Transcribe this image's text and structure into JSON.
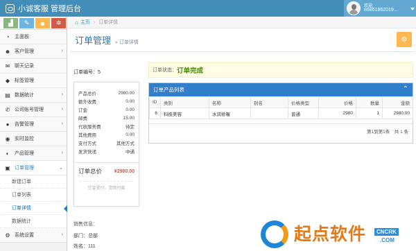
{
  "app": {
    "title": "小诚客服 管理后台"
  },
  "user": {
    "welcome": "欢迎,",
    "phone": "86861862019..."
  },
  "shortcuts": [
    {
      "icon": "signal-icon",
      "glyph": "▟",
      "color": "#87b87f"
    },
    {
      "icon": "pencil-icon",
      "glyph": "✎",
      "color": "#6fb3e0"
    },
    {
      "icon": "users-icon",
      "glyph": "☻",
      "color": "#ffb752"
    },
    {
      "icon": "cogs-icon",
      "glyph": "✲",
      "color": "#d15b47"
    }
  ],
  "sidebar": {
    "items": [
      {
        "label": "主面板",
        "icon": "dashboard-icon",
        "glyph": "◔",
        "arrow": ""
      },
      {
        "label": "客户管理",
        "icon": "users-icon",
        "glyph": "☻",
        "arrow": "›"
      },
      {
        "label": "聊天记录",
        "icon": "chat-icon",
        "glyph": "✉",
        "arrow": ""
      },
      {
        "label": "标签管理",
        "icon": "tag-icon",
        "glyph": "◆",
        "arrow": ""
      },
      {
        "label": "数据统计",
        "icon": "chart-icon",
        "glyph": "▤",
        "arrow": "›"
      },
      {
        "label": "公司账号管理",
        "icon": "phone-icon",
        "glyph": "✆",
        "arrow": "›"
      },
      {
        "label": "告警管理",
        "icon": "alert-icon",
        "glyph": "●",
        "arrow": "›"
      },
      {
        "label": "实时监控",
        "icon": "monitor-icon",
        "glyph": "◉",
        "arrow": ""
      },
      {
        "label": "产品管理",
        "icon": "product-icon",
        "glyph": "◐",
        "arrow": "›"
      },
      {
        "label": "订单管理",
        "icon": "order-icon",
        "glyph": "▣",
        "arrow": "⌄"
      }
    ],
    "subitems": [
      {
        "label": "新建订单"
      },
      {
        "label": "订单列表"
      },
      {
        "label": "订单详情"
      },
      {
        "label": "数据统计"
      }
    ],
    "last": {
      "label": "系统设置",
      "icon": "settings-icon",
      "glyph": "⚙",
      "arrow": "›"
    }
  },
  "breadcrumb": {
    "home": "主页",
    "current": "订单详情"
  },
  "page": {
    "title": "订单管理",
    "subtitle": "» 订单详情"
  },
  "order": {
    "number_label": "订单编号：5"
  },
  "receipt": {
    "rows": [
      {
        "label": "产品总价",
        "value": "2980.00"
      },
      {
        "label": "额外收费",
        "value": "0.00"
      },
      {
        "label": "订金",
        "value": "0.00"
      },
      {
        "label": "邮费",
        "value": "15.00"
      },
      {
        "label": "代收服务费",
        "value": "待定"
      },
      {
        "label": "其他费用",
        "value": "0.00"
      },
      {
        "label": "支付方式",
        "value": "其他方式"
      },
      {
        "label": "发货快递",
        "value": "中通"
      }
    ],
    "total_label": "订单总价",
    "total_value": "¥2980.00",
    "footer": "订金支付，货到付款"
  },
  "sales": {
    "title": "销售信息：",
    "dept": "部门：总部",
    "name": "姓名：111"
  },
  "status": {
    "label": "订单状态：",
    "value": "订单完成"
  },
  "products": {
    "title": "订单产品列表",
    "columns": [
      "ID",
      "类别",
      "名称",
      "别名",
      "价格类型",
      "价格",
      "数量",
      "金额"
    ],
    "rows": [
      {
        "id": "6",
        "category": "科技美容",
        "name": "水润修喔",
        "alias": "",
        "price_type": "普通",
        "price": "2980",
        "qty": "1",
        "amount": "2980.00"
      }
    ],
    "pager": "第1到第1条　共 1 条"
  },
  "watermark": {
    "text": "起点软件",
    "url": "CNCRK",
    "com": ".COM"
  }
}
